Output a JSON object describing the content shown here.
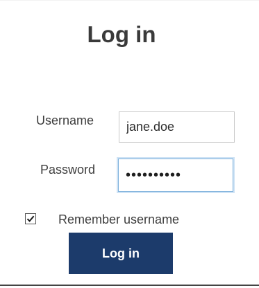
{
  "title": "Log in",
  "form": {
    "username_label": "Username",
    "username_value": "jane.doe",
    "password_label": "Password",
    "password_value": "••••••••••",
    "remember_label": "Remember username",
    "remember_checked": true,
    "submit_label": "Log in"
  },
  "colors": {
    "button_bg": "#1c3b6b",
    "button_text": "#ffffff",
    "focus_border": "#7fb2dc"
  },
  "icons": {
    "remember_checkbox": "checkmark-icon"
  }
}
